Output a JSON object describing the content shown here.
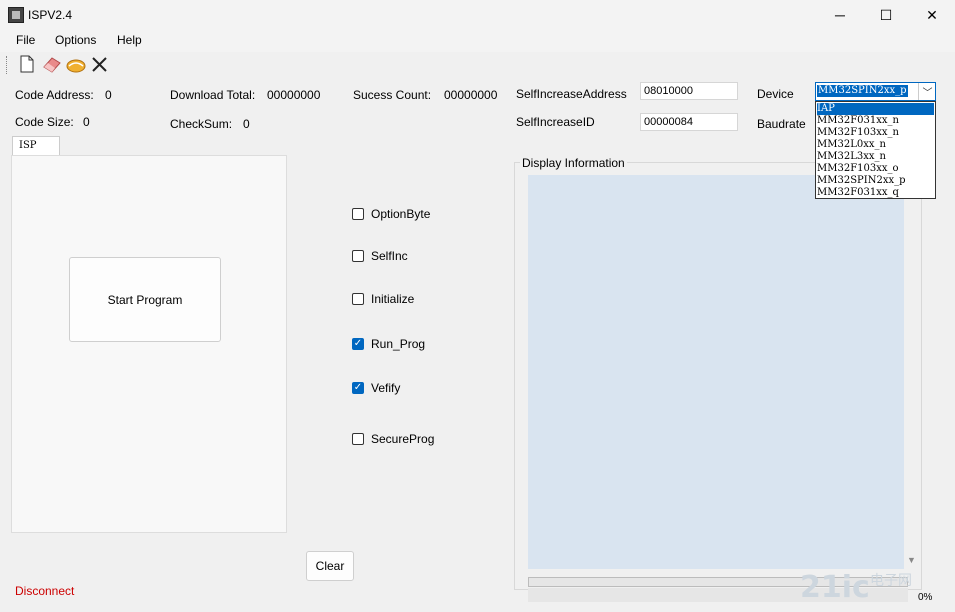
{
  "window": {
    "title": "ISPV2.4",
    "minimize": "─",
    "maximize": "☐",
    "close": "✕"
  },
  "menu": [
    "File",
    "Options",
    "Help"
  ],
  "toolbar": [
    "new-file-icon",
    "eraser-icon",
    "handshake-icon",
    "close-icon"
  ],
  "info": {
    "code_address_label": "Code Address:",
    "code_address_value": "0",
    "code_size_label": "Code Size:",
    "code_size_value": "0",
    "download_total_label": "Download Total:",
    "download_total_value": "00000000",
    "checksum_label": "CheckSum:",
    "checksum_value": "0",
    "success_count_label": "Sucess Count:",
    "success_count_value": "00000000",
    "self_increase_address_label": "SelfIncreaseAddress",
    "self_increase_address_value": "08010000",
    "self_increase_id_label": "SelfIncreaseID",
    "self_increase_id_value": "00000084",
    "device_label": "Device",
    "baudrate_label": "Baudrate"
  },
  "device": {
    "selected": "MM32SPIN2xx_p",
    "options": [
      "IAP",
      "MM32F031xx_n",
      "MM32F103xx_n",
      "MM32L0xx_n",
      "MM32L3xx_n",
      "MM32F103xx_o",
      "MM32SPIN2xx_p",
      "MM32F031xx_q"
    ],
    "highlighted": "IAP"
  },
  "tab": {
    "label": "ISP"
  },
  "start_button": "Start Program",
  "options": [
    {
      "label": "OptionByte",
      "checked": false
    },
    {
      "label": "SelfInc",
      "checked": false
    },
    {
      "label": "Initialize",
      "checked": false
    },
    {
      "label": "Run_Prog",
      "checked": true
    },
    {
      "label": "Vefify",
      "checked": true
    },
    {
      "label": "SecureProg",
      "checked": false
    }
  ],
  "display": {
    "legend": "Display Information",
    "progress_text": "0%",
    "progress": 0
  },
  "clear_button": "Clear",
  "status": {
    "text": "Disconnect",
    "color": "#cc0000"
  },
  "watermark": {
    "logo": "21ic",
    "text": "电子网"
  }
}
